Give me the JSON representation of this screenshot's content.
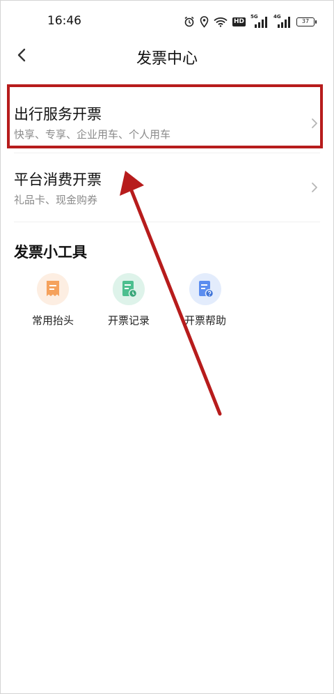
{
  "status_bar": {
    "time": "16:46",
    "signal1_label": "5G",
    "signal2_label": "4G",
    "hd_label": "HD",
    "battery": "37"
  },
  "header": {
    "title": "发票中心"
  },
  "menu": {
    "items": [
      {
        "title": "出行服务开票",
        "subtitle": "快享、专享、企业用车、个人用车"
      },
      {
        "title": "平台消费开票",
        "subtitle": "礼品卡、现金购券"
      }
    ]
  },
  "tools": {
    "title": "发票小工具",
    "items": [
      {
        "label": "常用抬头",
        "icon": "invoice-title-icon",
        "color": "#f5a25d"
      },
      {
        "label": "开票记录",
        "icon": "invoice-record-icon",
        "color": "#4cbf8f"
      },
      {
        "label": "开票帮助",
        "icon": "invoice-help-icon",
        "color": "#5b8def"
      }
    ]
  },
  "annotation": {
    "color": "#b71c1c"
  }
}
